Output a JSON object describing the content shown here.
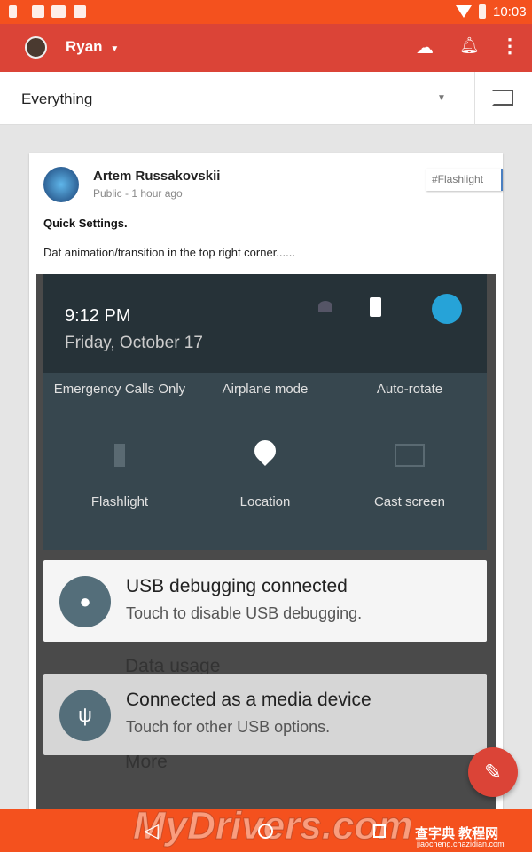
{
  "status_bar": {
    "time": "10:03",
    "icons": [
      "battery-charging-icon",
      "image-icon",
      "gmail-icon",
      "clipboard-icon",
      "wifi-icon",
      "battery-icon"
    ]
  },
  "app_bar": {
    "account_name": "Ryan",
    "icons": [
      "circles-icon",
      "bell-icon",
      "more-vert-icon"
    ]
  },
  "filter": {
    "selected": "Everything"
  },
  "post": {
    "author": "Artem Russakovskii",
    "meta": "Public - 1 hour ago",
    "hashtag": "#Flashlight",
    "title": "Quick Settings.",
    "body": "Dat animation/transition in the top right corner......",
    "image": {
      "time": "9:12 PM",
      "date": "Friday, October 17",
      "carrier": "Emergency Calls Only",
      "tiles_top": [
        "Airplane mode",
        "Auto-rotate"
      ],
      "tiles": [
        "Flashlight",
        "Location",
        "Cast screen"
      ],
      "notifications": [
        {
          "title": "USB debugging connected",
          "subtitle": "Touch to disable USB debugging."
        },
        {
          "title": "Connected as a media device",
          "subtitle": "Touch for other USB options."
        }
      ],
      "background_items": [
        "Data usage",
        "More"
      ]
    }
  },
  "colors": {
    "status_bar": "#f4511e",
    "app_bar": "#db4437",
    "fab": "#db4437"
  },
  "watermark": {
    "text": "MyDrivers.com",
    "site": "查字典 教程网",
    "url": "jiaocheng.chazidian.com"
  }
}
